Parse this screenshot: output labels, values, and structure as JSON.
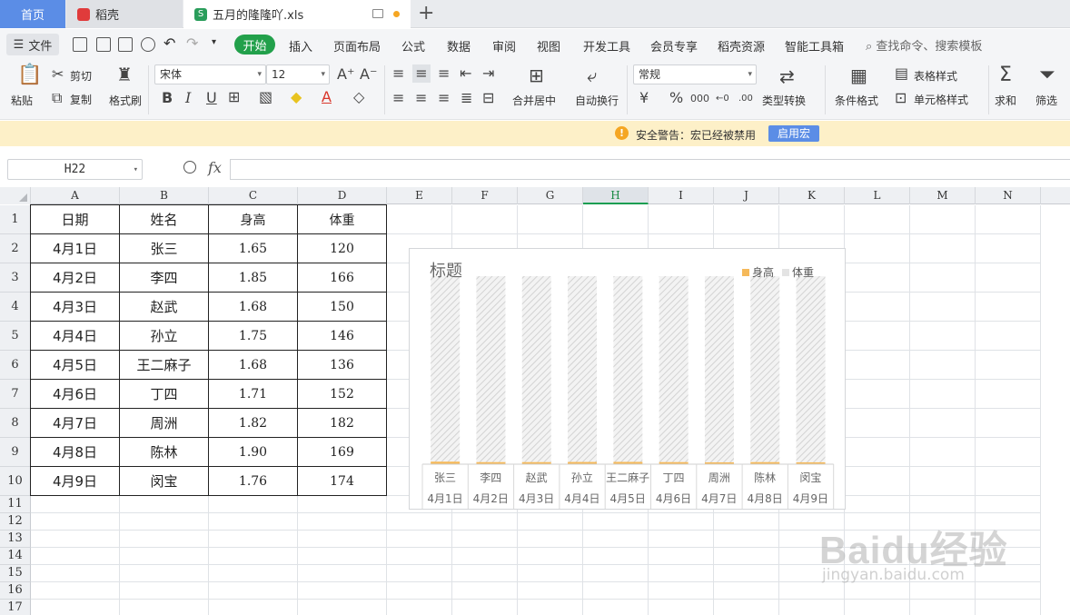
{
  "tabs": [
    {
      "label": "首页"
    },
    {
      "label": "稻壳"
    },
    {
      "label": "五月的隆隆吖.xls"
    }
  ],
  "menu": {
    "file": "文件",
    "items": [
      "开始",
      "插入",
      "页面布局",
      "公式",
      "数据",
      "审阅",
      "视图",
      "开发工具",
      "会员专享",
      "稻壳资源",
      "智能工具箱"
    ],
    "search": "查找命令、搜索模板"
  },
  "ribbon": {
    "paste": "粘贴",
    "cut": "剪切",
    "copy": "复制",
    "format_painter": "格式刷",
    "font_name": "宋体",
    "font_size": "12",
    "bold": "B",
    "italic": "I",
    "underline": "U",
    "merge_center": "合并居中",
    "wrap_text": "自动换行",
    "number_format": "常规",
    "type_convert": "类型转换",
    "cond_format": "条件格式",
    "table_style": "表格样式",
    "cell_style": "单元格样式",
    "sum": "求和",
    "filter": "筛选"
  },
  "warning": {
    "text": "安全警告：宏已经被禁用",
    "button": "启用宏"
  },
  "formula_bar": {
    "cell_ref": "H22",
    "formula": ""
  },
  "sheet": {
    "columns": [
      "A",
      "B",
      "C",
      "D",
      "E",
      "F",
      "G",
      "H",
      "I",
      "J",
      "K",
      "L",
      "M",
      "N"
    ],
    "selected_column": "H",
    "row_numbers": [
      "1",
      "2",
      "3",
      "4",
      "5",
      "6",
      "7",
      "8",
      "9",
      "10",
      "11",
      "12",
      "13",
      "14",
      "15",
      "16",
      "17"
    ],
    "table": {
      "headers": [
        "日期",
        "姓名",
        "身高",
        "体重"
      ],
      "rows": [
        [
          "4月1日",
          "张三",
          "1.65",
          "120"
        ],
        [
          "4月2日",
          "李四",
          "1.85",
          "166"
        ],
        [
          "4月3日",
          "赵武",
          "1.68",
          "150"
        ],
        [
          "4月4日",
          "孙立",
          "1.75",
          "146"
        ],
        [
          "4月5日",
          "王二麻子",
          "1.68",
          "136"
        ],
        [
          "4月6日",
          "丁四",
          "1.71",
          "152"
        ],
        [
          "4月7日",
          "周洲",
          "1.82",
          "182"
        ],
        [
          "4月8日",
          "陈林",
          "1.90",
          "169"
        ],
        [
          "4月9日",
          "闵宝",
          "1.76",
          "174"
        ]
      ]
    }
  },
  "chart_data": {
    "type": "bar",
    "stacked": true,
    "percent_stacked": true,
    "title": "标题",
    "legend_position": "top-right",
    "categories": [
      [
        "张三",
        "4月1日"
      ],
      [
        "李四",
        "4月2日"
      ],
      [
        "赵武",
        "4月3日"
      ],
      [
        "孙立",
        "4月4日"
      ],
      [
        "王二麻子",
        "4月5日"
      ],
      [
        "丁四",
        "4月6日"
      ],
      [
        "周洲",
        "4月7日"
      ],
      [
        "陈林",
        "4月8日"
      ],
      [
        "闵宝",
        "4月9日"
      ]
    ],
    "series": [
      {
        "name": "身高",
        "values": [
          1.65,
          1.85,
          1.68,
          1.75,
          1.68,
          1.71,
          1.82,
          1.9,
          1.76
        ],
        "color": "#f5b95a"
      },
      {
        "name": "体重",
        "values": [
          120,
          166,
          150,
          146,
          136,
          152,
          182,
          169,
          174
        ],
        "color": "#dcdcdc"
      }
    ]
  },
  "watermark": {
    "logo": "Baidu经验",
    "url": "jingyan.baidu.com"
  }
}
